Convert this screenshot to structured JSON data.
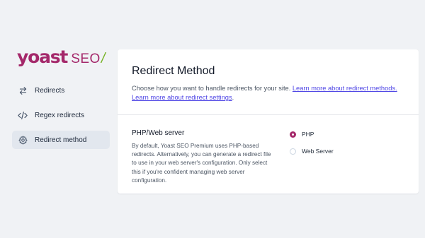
{
  "brand": {
    "name": "yoast",
    "suffix": "SEO",
    "slash": "/",
    "colors": {
      "primary": "#a4286a",
      "accent": "#77b227",
      "link": "#4f46e5"
    }
  },
  "sidebar": {
    "items": [
      {
        "label": "Redirects",
        "icon": "arrows-right-left-icon",
        "active": false
      },
      {
        "label": "Regex redirects",
        "icon": "code-icon",
        "active": false
      },
      {
        "label": "Redirect method",
        "icon": "gear-icon",
        "active": true
      }
    ]
  },
  "card": {
    "title": "Redirect Method",
    "description": "Choose how you want to handle redirects for your site.",
    "link_text": "Learn more about redirect methods.",
    "settings_link_text": "Learn more about redirect settings",
    "settings_link_suffix": "."
  },
  "section": {
    "title": "PHP/Web server",
    "description": "By default, Yoast SEO Premium uses PHP-based redirects. Alternatively, you can generate a redirect file to use in your web server's configuration. Only select this if you're confident managing web server configuration.",
    "options": [
      {
        "label": "PHP",
        "checked": true
      },
      {
        "label": "Web Server",
        "checked": false
      }
    ]
  }
}
